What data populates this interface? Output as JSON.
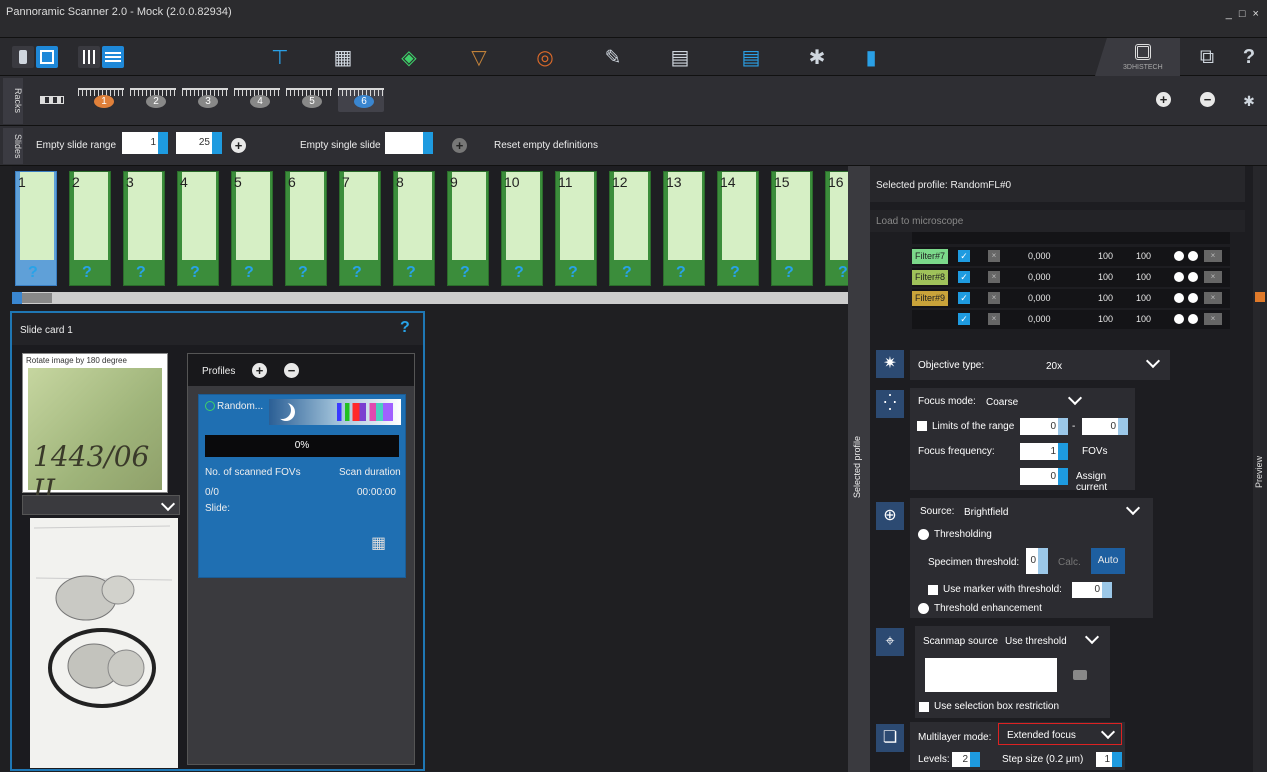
{
  "window": {
    "title": "Pannoramic Scanner 2.0 - Mock (2.0.0.82934)",
    "controls": "_ □ ×"
  },
  "toolbar": {
    "logo_text": "3DHISTECH",
    "help": "?"
  },
  "racks": {
    "tab_label": "Racks",
    "items": [
      "1",
      "2",
      "3",
      "4",
      "5",
      "6"
    ]
  },
  "slides_bar": {
    "tab_label": "Slides",
    "empty_range_label": "Empty slide range",
    "range_from": "1",
    "range_to": "25",
    "empty_single_label": "Empty single slide",
    "single_value": "",
    "reset_label": "Reset empty definitions"
  },
  "slide_strip": {
    "slides": [
      "1",
      "2",
      "3",
      "4",
      "5",
      "6",
      "7",
      "8",
      "9",
      "10",
      "11",
      "12",
      "13",
      "14",
      "15",
      "16"
    ],
    "marker": "?"
  },
  "slide_card": {
    "title": "Slide card 1",
    "help": "?",
    "rotate_label": "Rotate image by 180 degree",
    "label_text": "1443/06 II",
    "profiles_label": "Profiles",
    "profile": {
      "name": "Random...",
      "progress": "0%",
      "fov_label": "No. of scanned FOVs",
      "duration_label": "Scan duration",
      "fov_value": "0/0",
      "duration_value": "00:00:00",
      "slide_label": "Slide:"
    }
  },
  "profile_panel": {
    "vertical_label": "Selected profile",
    "title": "Selected profile: RandomFL#0",
    "load_label": "Load to microscope",
    "filters": [
      {
        "name": "Filter#7",
        "color": "#7bd88a",
        "value": "0,000",
        "a": "100",
        "b": "100"
      },
      {
        "name": "Filter#8",
        "color": "#9fc25a",
        "value": "0,000",
        "a": "100",
        "b": "100"
      },
      {
        "name": "Filter#9",
        "color": "#c9a33a",
        "value": "0,000",
        "a": "100",
        "b": "100"
      },
      {
        "name": "",
        "color": "#141417",
        "value": "0,000",
        "a": "100",
        "b": "100"
      }
    ],
    "objective": {
      "label": "Objective type:",
      "value": "20x"
    },
    "focus": {
      "mode_label": "Focus mode:",
      "mode_value": "Coarse",
      "limits_label": "Limits of the range",
      "limit_from": "0",
      "limit_sep": "-",
      "limit_to": "0",
      "freq_label": "Focus frequency:",
      "freq_value": "1",
      "freq_unit": "FOVs",
      "assign_value": "0",
      "assign_label": "Assign current"
    },
    "source": {
      "label": "Source:",
      "value": "Brightfield",
      "thresholding": "Thresholding",
      "spec_label": "Specimen threshold:",
      "spec_value": "0",
      "calc": "Calc.",
      "auto": "Auto",
      "marker_label": "Use marker with threshold:",
      "marker_value": "0",
      "enhancement": "Threshold enhancement"
    },
    "scanmap": {
      "label": "Scanmap source",
      "value": "Use threshold",
      "selection_label": "Use selection box restriction"
    },
    "multilayer": {
      "label": "Multilayer mode:",
      "value": "Extended focus",
      "levels_label": "Levels:",
      "levels_value": "2",
      "step_label": "Step size (0.2 μm)",
      "step_value": "1"
    }
  },
  "preview": {
    "label": "Preview"
  }
}
